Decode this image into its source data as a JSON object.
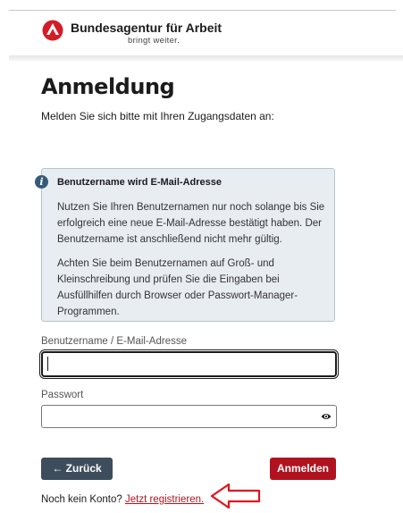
{
  "header": {
    "brand_name": "Bundesagentur für Arbeit",
    "brand_tagline": "bringt weiter."
  },
  "page": {
    "title": "Anmeldung",
    "intro": "Melden Sie sich bitte mit Ihren Zugangsdaten an:"
  },
  "info_box": {
    "title": "Benutzername wird E-Mail-Adresse",
    "paragraph_1": "Nutzen Sie Ihren Benutzernamen nur noch solange bis Sie erfolgreich eine neue E-Mail-Adresse bestätigt haben. Der Benutzername ist anschließend nicht mehr gültig.",
    "paragraph_2": "Achten Sie beim Benutzernamen auf Groß- und Kleinschreibung und prüfen Sie die Eingaben bei Ausfüllhilfen durch Browser oder Passwort-Manager-Programmen."
  },
  "form": {
    "username_label": "Benutzername / E-Mail-Adresse",
    "username_value": "",
    "password_label": "Passwort",
    "password_value": ""
  },
  "buttons": {
    "back_label": "← Zurück",
    "login_label": "Anmelden"
  },
  "register": {
    "prompt": "Noch kein Konto? ",
    "link_label": "Jetzt registrieren."
  },
  "colors": {
    "brand_red": "#b0131f",
    "back_button": "#3e4d5c",
    "info_background": "#e8edf2"
  }
}
